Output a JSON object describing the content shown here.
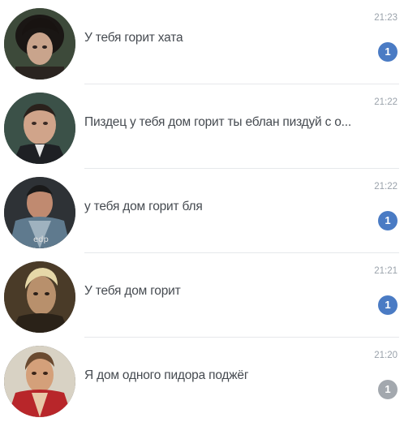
{
  "chats": [
    {
      "message": "У тебя горит хата",
      "time": "21:23",
      "unread": "1",
      "badge_color": "#4a7bc4",
      "avatar_icon": "woman-dark-hair-avatar"
    },
    {
      "message": "Пиздец у тебя дом горит ты еблан пиздуй с о...",
      "time": "21:22",
      "unread": "",
      "badge_color": "",
      "avatar_icon": "man-suit-avatar"
    },
    {
      "message": "у тебя дом горит бля",
      "time": "21:22",
      "unread": "1",
      "badge_color": "#4a7bc4",
      "avatar_icon": "man-big-shirt-avatar"
    },
    {
      "message": "У тебя дом горит",
      "time": "21:21",
      "unread": "1",
      "badge_color": "#4a7bc4",
      "avatar_icon": "man-blond-avatar"
    },
    {
      "message": "Я дом одного пидора поджёг",
      "time": "21:20",
      "unread": "1",
      "badge_color": "#a3a8ae",
      "avatar_icon": "man-red-jacket-avatar"
    }
  ]
}
